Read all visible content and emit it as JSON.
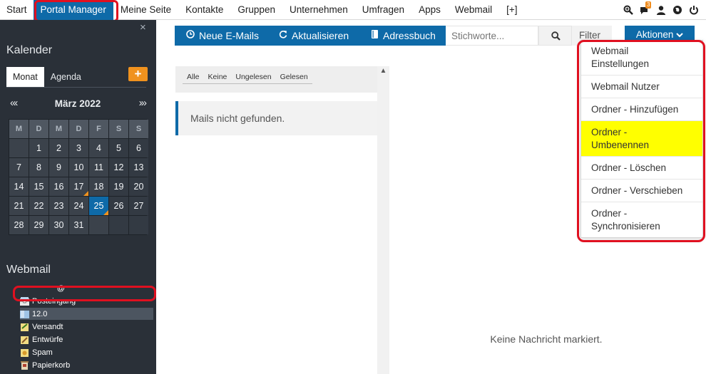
{
  "nav": {
    "items": [
      "Start",
      "Portal Manager",
      "Meine Seite",
      "Kontakte",
      "Gruppen",
      "Unternehmen",
      "Umfragen",
      "Apps",
      "Webmail",
      "[+]"
    ],
    "active_index": 1,
    "badge_count": "3"
  },
  "sidebar": {
    "close_glyph": "×",
    "calendar_title": "Kalender",
    "tabs": [
      "Monat",
      "Agenda"
    ],
    "add_glyph": "+",
    "prev_glyph": "«‹",
    "next_glyph": "›»",
    "month_label": "März 2022",
    "weekday_headers": [
      "M",
      "D",
      "M",
      "D",
      "F",
      "S",
      "S"
    ],
    "webmail_title": "Webmail",
    "tree_root": "@",
    "folders": [
      "Posteingang",
      "12.0",
      "Versandt",
      "Entwürfe",
      "Spam",
      "Papierkorb"
    ],
    "selected_folder": "12.0"
  },
  "toolbar": {
    "new_mails": "Neue E-Mails",
    "refresh": "Aktualisieren",
    "address_book": "Adressbuch",
    "search_placeholder": "Stichworte...",
    "filter": "Filter",
    "actions": "Aktionen"
  },
  "list": {
    "filters": [
      "Alle",
      "Keine",
      "Ungelesen",
      "Gelesen"
    ],
    "empty_message": "Mails nicht gefunden."
  },
  "preview": {
    "message": "Keine Nachricht markiert."
  },
  "actions_menu": {
    "items": [
      "Webmail Einstellungen",
      "Webmail Nutzer",
      "Ordner - Hinzufügen",
      "Ordner - Umbenennen",
      "Ordner - Löschen",
      "Ordner - Verschieben",
      "Ordner - Synchronisieren"
    ],
    "highlighted": "Ordner - Umbenennen"
  },
  "colors": {
    "accent": "#0e6aa8",
    "sidebar_bg": "#2a3038",
    "orange": "#f0921e",
    "highlight_yellow": "#ffff00",
    "annotation_red": "#e01020"
  }
}
